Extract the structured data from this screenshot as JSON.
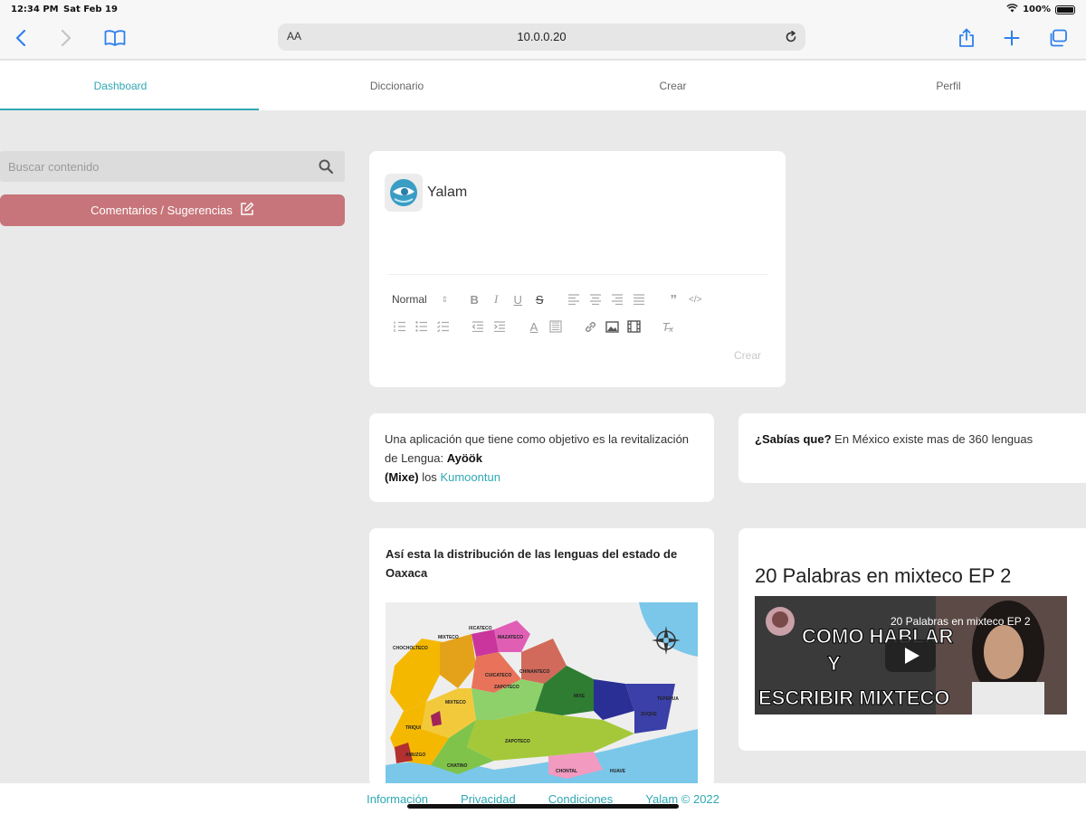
{
  "status_bar": {
    "time": "12:34 PM",
    "date": "Sat Feb 19",
    "battery": "100%",
    "wifi_icon": "wifi-icon",
    "battery_icon": "battery-icon"
  },
  "browser": {
    "aa_label": "AA",
    "url": "10.0.0.20",
    "icons": [
      "back-icon",
      "forward-icon",
      "bookmarks-icon",
      "reload-icon",
      "share-icon",
      "new-tab-icon",
      "tabs-icon"
    ]
  },
  "nav": {
    "tabs": [
      {
        "label": "Dashboard",
        "active": true
      },
      {
        "label": "Diccionario",
        "active": false
      },
      {
        "label": "Crear",
        "active": false
      },
      {
        "label": "Perfil",
        "active": false
      }
    ],
    "accent_color": "#2fa9b3"
  },
  "sidebar": {
    "search_placeholder": "Buscar contenido",
    "feedback_label": "Comentarios / Sugerencias",
    "feedback_color": "#c7757a"
  },
  "editor": {
    "brand_name": "Yalam",
    "format_value": "Normal",
    "create_label": "Crear"
  },
  "about": {
    "text_1": "Una aplicación que tiene como objetivo es la revitalización de Lengua:",
    "language": "Ayöök",
    "language_note": "(Mixe)",
    "text_2": "los",
    "link": "Kumoontun"
  },
  "fact": {
    "lead": "¿Sabías que?",
    "text": "En México existe mas de 360 lenguas"
  },
  "map": {
    "title": "Así esta la distribución de las lenguas del estado de Oaxaca",
    "labels": [
      "CHOCHOLTECO",
      "MIXTECO",
      "IXCATECO",
      "MAZATECO",
      "CHINANTECO",
      "CUICATECO",
      "MIXTECO",
      "ZAPOTECO",
      "MIXE",
      "ZOQUE",
      "TRIQUI",
      "AMUZGO",
      "CHATINO",
      "ZAPOTECO",
      "HUAVE",
      "CHONTAL",
      "TEPEHUA"
    ]
  },
  "video": {
    "title": "20 Palabras en mixteco EP 2",
    "overlay_title": "20 Palabras en mixteco EP 2",
    "thumb_line_1": "COMO HABLAR",
    "thumb_line_2": "Y",
    "thumb_line_3": "ESCRIBIR MIXTECO"
  },
  "footer": {
    "links": [
      "Información",
      "Privacidad",
      "Condiciones"
    ],
    "copyright": "Yalam © 2022"
  }
}
